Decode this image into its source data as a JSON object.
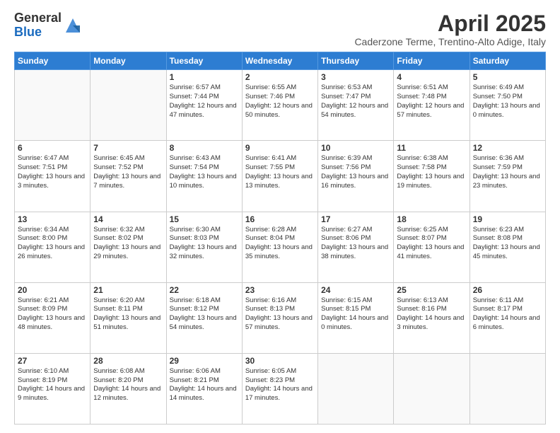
{
  "logo": {
    "general": "General",
    "blue": "Blue"
  },
  "title": "April 2025",
  "location": "Caderzone Terme, Trentino-Alto Adige, Italy",
  "weekdays": [
    "Sunday",
    "Monday",
    "Tuesday",
    "Wednesday",
    "Thursday",
    "Friday",
    "Saturday"
  ],
  "weeks": [
    [
      {
        "day": "",
        "info": ""
      },
      {
        "day": "",
        "info": ""
      },
      {
        "day": "1",
        "info": "Sunrise: 6:57 AM\nSunset: 7:44 PM\nDaylight: 12 hours and 47 minutes."
      },
      {
        "day": "2",
        "info": "Sunrise: 6:55 AM\nSunset: 7:46 PM\nDaylight: 12 hours and 50 minutes."
      },
      {
        "day": "3",
        "info": "Sunrise: 6:53 AM\nSunset: 7:47 PM\nDaylight: 12 hours and 54 minutes."
      },
      {
        "day": "4",
        "info": "Sunrise: 6:51 AM\nSunset: 7:48 PM\nDaylight: 12 hours and 57 minutes."
      },
      {
        "day": "5",
        "info": "Sunrise: 6:49 AM\nSunset: 7:50 PM\nDaylight: 13 hours and 0 minutes."
      }
    ],
    [
      {
        "day": "6",
        "info": "Sunrise: 6:47 AM\nSunset: 7:51 PM\nDaylight: 13 hours and 3 minutes."
      },
      {
        "day": "7",
        "info": "Sunrise: 6:45 AM\nSunset: 7:52 PM\nDaylight: 13 hours and 7 minutes."
      },
      {
        "day": "8",
        "info": "Sunrise: 6:43 AM\nSunset: 7:54 PM\nDaylight: 13 hours and 10 minutes."
      },
      {
        "day": "9",
        "info": "Sunrise: 6:41 AM\nSunset: 7:55 PM\nDaylight: 13 hours and 13 minutes."
      },
      {
        "day": "10",
        "info": "Sunrise: 6:39 AM\nSunset: 7:56 PM\nDaylight: 13 hours and 16 minutes."
      },
      {
        "day": "11",
        "info": "Sunrise: 6:38 AM\nSunset: 7:58 PM\nDaylight: 13 hours and 19 minutes."
      },
      {
        "day": "12",
        "info": "Sunrise: 6:36 AM\nSunset: 7:59 PM\nDaylight: 13 hours and 23 minutes."
      }
    ],
    [
      {
        "day": "13",
        "info": "Sunrise: 6:34 AM\nSunset: 8:00 PM\nDaylight: 13 hours and 26 minutes."
      },
      {
        "day": "14",
        "info": "Sunrise: 6:32 AM\nSunset: 8:02 PM\nDaylight: 13 hours and 29 minutes."
      },
      {
        "day": "15",
        "info": "Sunrise: 6:30 AM\nSunset: 8:03 PM\nDaylight: 13 hours and 32 minutes."
      },
      {
        "day": "16",
        "info": "Sunrise: 6:28 AM\nSunset: 8:04 PM\nDaylight: 13 hours and 35 minutes."
      },
      {
        "day": "17",
        "info": "Sunrise: 6:27 AM\nSunset: 8:06 PM\nDaylight: 13 hours and 38 minutes."
      },
      {
        "day": "18",
        "info": "Sunrise: 6:25 AM\nSunset: 8:07 PM\nDaylight: 13 hours and 41 minutes."
      },
      {
        "day": "19",
        "info": "Sunrise: 6:23 AM\nSunset: 8:08 PM\nDaylight: 13 hours and 45 minutes."
      }
    ],
    [
      {
        "day": "20",
        "info": "Sunrise: 6:21 AM\nSunset: 8:09 PM\nDaylight: 13 hours and 48 minutes."
      },
      {
        "day": "21",
        "info": "Sunrise: 6:20 AM\nSunset: 8:11 PM\nDaylight: 13 hours and 51 minutes."
      },
      {
        "day": "22",
        "info": "Sunrise: 6:18 AM\nSunset: 8:12 PM\nDaylight: 13 hours and 54 minutes."
      },
      {
        "day": "23",
        "info": "Sunrise: 6:16 AM\nSunset: 8:13 PM\nDaylight: 13 hours and 57 minutes."
      },
      {
        "day": "24",
        "info": "Sunrise: 6:15 AM\nSunset: 8:15 PM\nDaylight: 14 hours and 0 minutes."
      },
      {
        "day": "25",
        "info": "Sunrise: 6:13 AM\nSunset: 8:16 PM\nDaylight: 14 hours and 3 minutes."
      },
      {
        "day": "26",
        "info": "Sunrise: 6:11 AM\nSunset: 8:17 PM\nDaylight: 14 hours and 6 minutes."
      }
    ],
    [
      {
        "day": "27",
        "info": "Sunrise: 6:10 AM\nSunset: 8:19 PM\nDaylight: 14 hours and 9 minutes."
      },
      {
        "day": "28",
        "info": "Sunrise: 6:08 AM\nSunset: 8:20 PM\nDaylight: 14 hours and 12 minutes."
      },
      {
        "day": "29",
        "info": "Sunrise: 6:06 AM\nSunset: 8:21 PM\nDaylight: 14 hours and 14 minutes."
      },
      {
        "day": "30",
        "info": "Sunrise: 6:05 AM\nSunset: 8:23 PM\nDaylight: 14 hours and 17 minutes."
      },
      {
        "day": "",
        "info": ""
      },
      {
        "day": "",
        "info": ""
      },
      {
        "day": "",
        "info": ""
      }
    ]
  ]
}
